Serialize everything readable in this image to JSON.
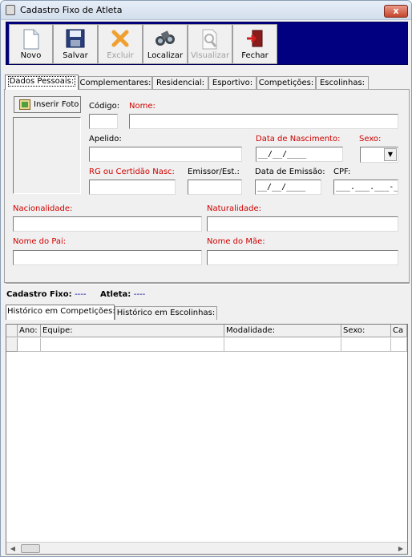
{
  "window": {
    "title": "Cadastro Fixo de Atleta",
    "close_glyph": "x"
  },
  "toolbar": {
    "novo": "Novo",
    "salvar": "Salvar",
    "excluir": "Excluir",
    "localizar": "Localizar",
    "visualizar": "Visualizar",
    "fechar": "Fechar"
  },
  "tabs": [
    "Dados Pessoais:",
    "Complementares:",
    "Residencial:",
    "Esportivo:",
    "Competições:",
    "Escolinhas:"
  ],
  "form": {
    "inserir_foto": "Inserir Foto",
    "codigo_label": "Código:",
    "codigo_value": "",
    "nome_label": "Nome:",
    "nome_value": "",
    "apelido_label": "Apelido:",
    "apelido_value": "",
    "nascimento_label": "Data de Nascimento:",
    "nascimento_value": "__/__/____",
    "sexo_label": "Sexo:",
    "sexo_value": "",
    "rg_label": "RG ou Certidão Nasc:",
    "rg_value": "",
    "emissor_label": "Emissor/Est.:",
    "emissor_value": "",
    "emissao_label": "Data de Emissão:",
    "emissao_value": "__/__/____",
    "cpf_label": "CPF:",
    "cpf_value": "___.___.___-__",
    "nacionalidade_label": "Nacionalidade:",
    "nacionalidade_value": "",
    "naturalidade_label": "Naturalidade:",
    "naturalidade_value": "",
    "pai_label": "Nome do Pai:",
    "pai_value": "",
    "mae_label": "Nome do Mãe:",
    "mae_value": ""
  },
  "info": {
    "cadastro_label": "Cadastro Fixo:",
    "cadastro_value": "----",
    "atleta_label": "Atleta:",
    "atleta_value": "----"
  },
  "subtabs": [
    "Histórico em Competições:",
    "Histórico em Escolinhas:"
  ],
  "grid": {
    "columns": [
      "Ano:",
      "Equipe:",
      "Modalidade:",
      "Sexo:",
      "Ca"
    ]
  },
  "colors": {
    "required_label": "#d00000",
    "toolbar_bg": "#000080"
  }
}
